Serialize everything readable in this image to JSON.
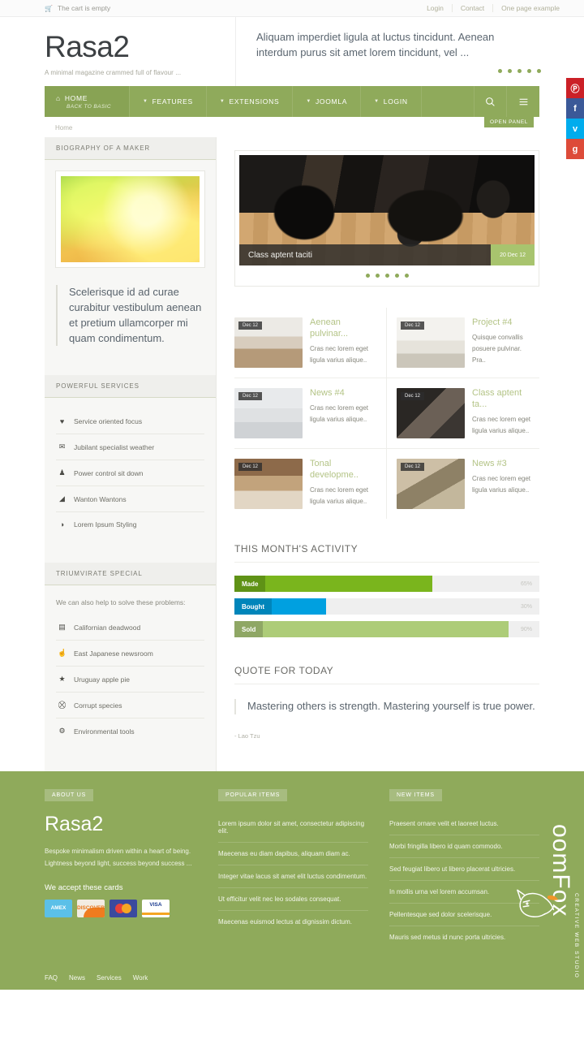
{
  "topbar": {
    "cart_icon": "cart-icon",
    "cart_text": "The cart is empty",
    "links": [
      {
        "label": "Login"
      },
      {
        "label": "Contact"
      },
      {
        "label": "One page example"
      }
    ]
  },
  "header": {
    "logo": "Rasa2",
    "tagline": "A minimal magazine crammed full of flavour ...",
    "message": "Aliquam imperdiet ligula at luctus tincidunt. Aenean interdum purus sit amet lorem tincidunt, vel ...",
    "dots": 5
  },
  "nav": {
    "items": [
      {
        "label": "HOME",
        "sub": "BACK TO BASIC",
        "icon": "home-icon",
        "active": true
      },
      {
        "label": "FEATURES",
        "icon": "chevron-down-icon"
      },
      {
        "label": "EXTENSIONS",
        "icon": "chevron-down-icon"
      },
      {
        "label": "JOOMLA",
        "icon": "chevron-down-icon"
      },
      {
        "label": "LOGIN",
        "icon": "chevron-down-icon"
      }
    ],
    "search_icon": "search-icon",
    "menu_icon": "hamburger-menu-icon",
    "open_panel_label": "OPEN PANEL"
  },
  "breadcrumb": "Home",
  "sidebar": {
    "modules": [
      {
        "title": "BIOGRAPHY OF A MAKER",
        "quote": "Scelerisque id ad curae curabitur vestibulum aenean et pretium ullamcorper mi quam condimentum."
      },
      {
        "title": "POWERFUL SERVICES",
        "items": [
          {
            "icon": "heart-icon",
            "glyph": "♥",
            "label": "Service oriented focus"
          },
          {
            "icon": "envelope-icon",
            "glyph": "✉",
            "label": "Jubilant specialist weather"
          },
          {
            "icon": "user-icon",
            "glyph": "♟",
            "label": "Power control sit down"
          },
          {
            "icon": "bar-chart-icon",
            "glyph": "◢",
            "label": "Wanton Wantons"
          },
          {
            "icon": "adjust-icon",
            "glyph": "◑",
            "label": "Lorem Ipsum Styling"
          }
        ]
      },
      {
        "title": "TRIUMVIRATE SPECIAL",
        "intro": "We can also help to solve these problems:",
        "items": [
          {
            "icon": "book-icon",
            "glyph": "▤",
            "label": "Californian deadwood"
          },
          {
            "icon": "thumbs-up-icon",
            "glyph": "☝",
            "label": "East Japanese newsroom"
          },
          {
            "icon": "star-icon",
            "glyph": "★",
            "label": "Uruguay apple pie"
          },
          {
            "icon": "car-icon",
            "glyph": "⛒",
            "label": "Corrupt species"
          },
          {
            "icon": "gear-icon",
            "glyph": "⚙",
            "label": "Environmental tools"
          }
        ]
      }
    ]
  },
  "slider": {
    "caption": "Class aptent taciti",
    "date": "20 Dec 12",
    "dots": 5
  },
  "articles": [
    {
      "date": "Dec 12",
      "title": "Aenean pulvinar...",
      "text": "Cras nec lorem eget ligula varius alique..",
      "thumb": "t1"
    },
    {
      "date": "Dec 12",
      "title": "Project #4",
      "text": "Quisque convallis posuere pulvinar. Pra..",
      "thumb": "t2"
    },
    {
      "date": "Dec 12",
      "title": "News #4",
      "text": "Cras nec lorem eget ligula varius alique..",
      "thumb": "t3"
    },
    {
      "date": "Dec 12",
      "title": "Class aptent ta...",
      "text": "Cras nec lorem eget ligula varius alique..",
      "thumb": "t4"
    },
    {
      "date": "Dec 12",
      "title": "Tonal developme..",
      "text": "Cras nec lorem eget ligula varius alique..",
      "thumb": "t5"
    },
    {
      "date": "Dec 12",
      "title": "News #3",
      "text": "Cras nec lorem eget ligula varius alique..",
      "thumb": "t6"
    }
  ],
  "activity": {
    "title": "THIS MONTH'S ACTIVITY"
  },
  "chart_data": {
    "type": "bar",
    "title": "THIS MONTH'S ACTIVITY",
    "orientation": "horizontal",
    "categories": [
      "Made",
      "Bought",
      "Sold"
    ],
    "values": [
      65,
      30,
      90
    ],
    "value_labels": [
      "65%",
      "30%",
      "90%"
    ],
    "colors": [
      "#7ab51d",
      "#00a0e0",
      "#adcc78"
    ],
    "label_colors": [
      "#5f9216",
      "#0085ba",
      "#8fa765"
    ],
    "track_color": "#efefef",
    "xlabel": "",
    "ylabel": "",
    "xlim": [
      0,
      100
    ],
    "grid": false,
    "legend": "none"
  },
  "quote": {
    "title": "QUOTE FOR TODAY",
    "text": "Mastering others is strength. Mastering yourself is true power.",
    "author": "- Lao Tzu"
  },
  "footer": {
    "about": {
      "badge": "ABOUT US",
      "logo": "Rasa2",
      "desc": "Bespoke minimalism driven within a heart of being. Lightness beyond light, success beyond success ...",
      "cards_label": "We accept these cards",
      "cards": [
        {
          "name": "AMEX",
          "key": "amex"
        },
        {
          "name": "DISCOVER",
          "key": "disc"
        },
        {
          "name": "",
          "key": "mc"
        },
        {
          "name": "VISA",
          "key": "visa"
        }
      ]
    },
    "popular": {
      "badge": "POPULAR ITEMS",
      "items": [
        "Lorem ipsum dolor sit amet, consectetur adipiscing elit.",
        "Maecenas eu diam dapibus, aliquam diam ac.",
        "Integer vitae lacus sit amet elit luctus condimentum.",
        "Ut efficitur velit nec leo sodales consequat.",
        "Maecenas euismod lectus at dignissim dictum."
      ]
    },
    "newitems": {
      "badge": "NEW ITEMS",
      "items": [
        "Praesent ornare velit et laoreet luctus.",
        "Morbi fringilla libero id quam commodo.",
        "Sed feugiat libero ut libero placerat ultricies.",
        "In mollis urna vel lorem accumsan.",
        "Pellentesque sed dolor scelerisque.",
        "Mauris sed metus id nunc porta ultricies."
      ]
    },
    "bottom_links": [
      {
        "label": "FAQ"
      },
      {
        "label": "News"
      },
      {
        "label": "Services"
      },
      {
        "label": "Work"
      }
    ],
    "studio": {
      "name": "oomFox",
      "sub": "CREATIVE WEB STUDIO"
    }
  },
  "social": [
    {
      "key": "pin",
      "glyph": "Ⓟ",
      "name": "pinterest-icon"
    },
    {
      "key": "fb",
      "glyph": "f",
      "name": "facebook-icon"
    },
    {
      "key": "tw",
      "glyph": "ᴠ",
      "name": "twitter-icon"
    },
    {
      "key": "gp",
      "glyph": "g",
      "name": "google-plus-icon"
    }
  ]
}
